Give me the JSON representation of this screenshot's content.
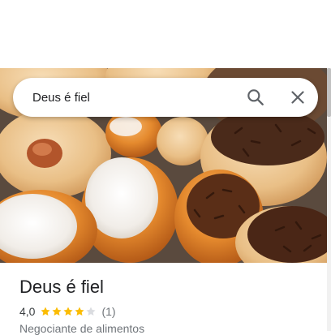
{
  "search": {
    "value": "Deus é fiel",
    "search_icon": "search-icon",
    "close_icon": "close-icon"
  },
  "place": {
    "title": "Deus é fiel",
    "rating": "4,0",
    "stars_filled": 4,
    "stars_total": 5,
    "review_count": "(1)",
    "category": "Negociante de alimentos"
  },
  "colors": {
    "star_filled": "#fbbc04",
    "star_empty": "#dadce0",
    "icon": "#5f6368"
  }
}
